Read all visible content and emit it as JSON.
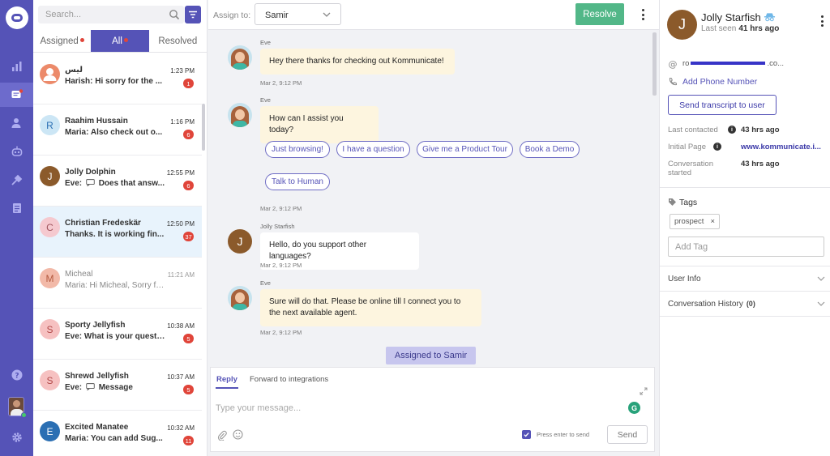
{
  "search": {
    "placeholder": "Search..."
  },
  "tabs": [
    {
      "label": "Assigned",
      "dot": true
    },
    {
      "label": "All",
      "dot": true
    },
    {
      "label": "Resolved",
      "dot": false
    }
  ],
  "conversations": [
    {
      "name": "ليس",
      "initial": "",
      "avatar_color": "#ec8a6a",
      "preview": "Harish: Hi sorry for the ...",
      "time": "1:23 PM",
      "badge": "1",
      "read": false
    },
    {
      "name": "Raahim Hussain",
      "initial": "R",
      "avatar_color": "#cce6f5",
      "preview": "Maria: Also check out o...",
      "time": "1:16 PM",
      "badge": "6",
      "read": false
    },
    {
      "name": "Jolly Dolphin",
      "initial": "J",
      "avatar_color": "#8b5a2b",
      "preview_sender": "Eve:",
      "preview": "Does that answ...",
      "time": "12:55 PM",
      "badge": "6",
      "read": false
    },
    {
      "name": "Christian Fredeskär",
      "initial": "C",
      "avatar_color": "#f5c9cf",
      "preview": "Thanks. It is working fin...",
      "time": "12:50 PM",
      "badge": "37",
      "read": false
    },
    {
      "name": "Micheal",
      "initial": "M",
      "avatar_color": "#f2b9a8",
      "preview": "Maria: Hi Micheal, Sorry fo...",
      "time": "11:21 AM",
      "badge": "",
      "read": true
    },
    {
      "name": "Sporty Jellyfish",
      "initial": "S",
      "avatar_color": "#f6c1c1",
      "preview": "Eve: What is your questi...",
      "time": "10:38 AM",
      "badge": "5",
      "read": false
    },
    {
      "name": "Shrewd Jellyfish",
      "initial": "S",
      "avatar_color": "#f6c1c1",
      "preview_sender": "Eve:",
      "preview": "Message",
      "time": "10:37 AM",
      "badge": "5",
      "read": false
    },
    {
      "name": "Excited Manatee",
      "initial": "E",
      "avatar_color": "#2b6fb3",
      "preview": "Maria: You can add Sug...",
      "time": "10:32 AM",
      "badge": "11",
      "read": false
    }
  ],
  "topbar": {
    "assign_label": "Assign to:",
    "assignee": "Samir",
    "resolve_label": "Resolve"
  },
  "messages": [
    {
      "sender": "Eve",
      "text": "Hey there thanks for checking out Kommunicate!",
      "timestamp": "Mar 2, 9:12 PM"
    },
    {
      "sender": "Eve",
      "text": "How can I assist you today?",
      "timestamp": "Mar 2, 9:12 PM"
    },
    {
      "sender": "Jolly Starfish",
      "initial": "J",
      "text": "Hello, do you support other languages?",
      "timestamp": "Mar 2, 9:12 PM"
    },
    {
      "sender": "Eve",
      "text": "Sure will do that. Please be online till I connect you to the next available agent.",
      "timestamp": "Mar 2, 9:12 PM"
    }
  ],
  "quick_replies": [
    "Just browsing!",
    "I have a question",
    "Give me a Product Tour",
    "Book a Demo",
    "Talk to Human"
  ],
  "assigned_notice": "Assigned to Samir",
  "reply_box": {
    "tabs": [
      "Reply",
      "Forward to integrations"
    ],
    "placeholder": "Type your message...",
    "enter_to_send": "Press enter to send",
    "send_label": "Send"
  },
  "contact": {
    "initial": "J",
    "name": "Jolly Starfish",
    "last_seen_label": "Last seen",
    "last_seen": "41 hrs ago",
    "email_prefix": "ro",
    "email_suffix": ".co...",
    "add_phone": "Add Phone Number",
    "transcript_label": "Send transcript to user",
    "details": [
      {
        "label": "Last contacted",
        "value": "43 hrs ago"
      },
      {
        "label": "Initial Page",
        "value": "www.kommunicate.i..."
      },
      {
        "label": "Conversation started",
        "value": "43 hrs ago"
      }
    ],
    "tags_title": "Tags",
    "tags": [
      "prospect"
    ],
    "add_tag_placeholder": "Add Tag",
    "sections": [
      {
        "title": "User Info",
        "count": ""
      },
      {
        "title": "Conversation History",
        "count": "(0)"
      }
    ]
  },
  "colors": {
    "brand": "#5553b7",
    "resolve": "#52b788",
    "badge": "#e0453a",
    "bot_bubble": "#fdf5df"
  }
}
